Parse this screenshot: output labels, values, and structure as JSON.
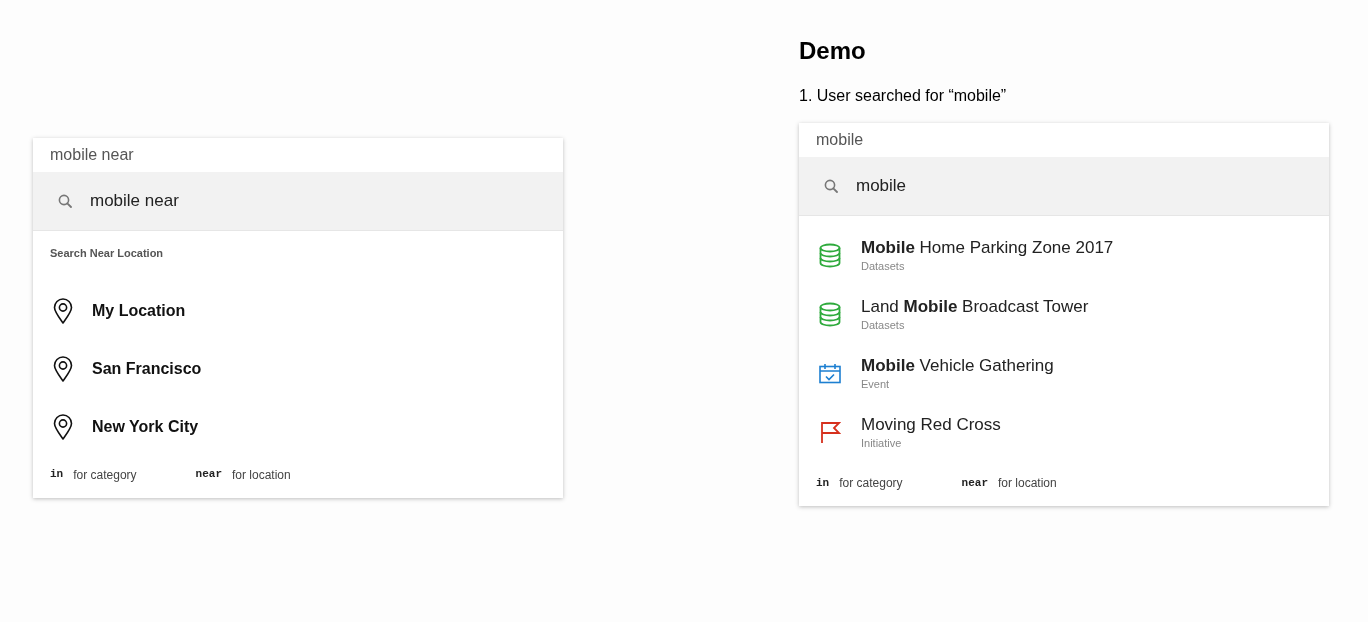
{
  "left_panel": {
    "input": {
      "value": "mobile near"
    },
    "query_row": {
      "text": "mobile near"
    },
    "section_label": "Search Near Location",
    "locations": [
      {
        "label": "My Location"
      },
      {
        "label": "San Francisco"
      },
      {
        "label": "New York City"
      }
    ],
    "hints": [
      {
        "key": "in",
        "text": "for category"
      },
      {
        "key": "near",
        "text": "for location"
      }
    ]
  },
  "demo": {
    "title": "Demo",
    "step": "1. User searched for “mobile”"
  },
  "right_panel": {
    "input": {
      "value": "mobile"
    },
    "query_row": {
      "text": "mobile"
    },
    "results": [
      {
        "kind": "dataset",
        "title": "**Mobile** Home Parking Zone 2017",
        "type": "Datasets"
      },
      {
        "kind": "dataset",
        "title": "Land **Mobile** Broadcast Tower",
        "type": "Datasets"
      },
      {
        "kind": "event",
        "title": "**Mobile** Vehicle Gathering",
        "type": "Event"
      },
      {
        "kind": "initiative",
        "title": "Moving Red Cross",
        "type": "Initiative"
      }
    ],
    "hints": [
      {
        "key": "in",
        "text": "for category"
      },
      {
        "key": "near",
        "text": "for location"
      }
    ]
  }
}
